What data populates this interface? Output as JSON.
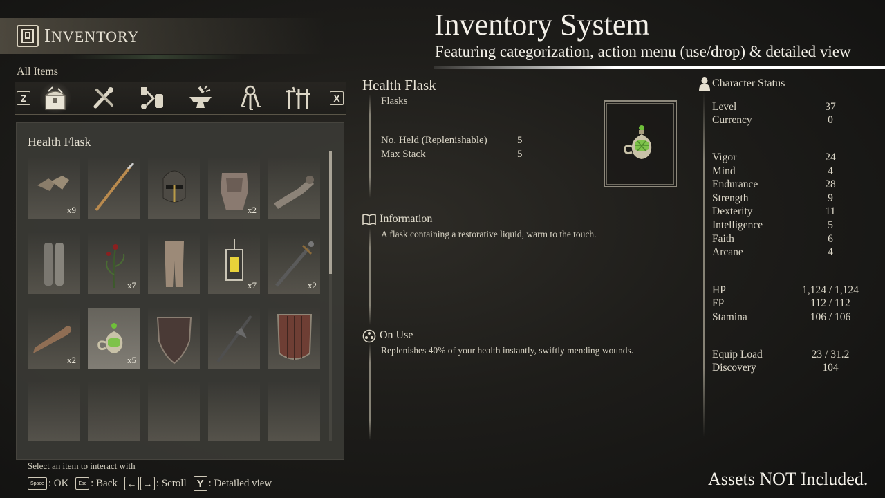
{
  "header": {
    "inventory_title_cap": "I",
    "inventory_title_rest": "NVENTORY",
    "main_title": "Inventory System",
    "sub_title": "Featuring categorization, action menu (use/drop) & detailed view"
  },
  "filter": {
    "label": "All Items",
    "prev_key": "Z",
    "next_key": "X",
    "categories": [
      {
        "icon": "chest-icon",
        "active": true
      },
      {
        "icon": "tools-icon",
        "active": false
      },
      {
        "icon": "crafting-icon",
        "active": false
      },
      {
        "icon": "anvil-icon",
        "active": false
      },
      {
        "icon": "keys-icon",
        "active": false
      },
      {
        "icon": "weapons-icon",
        "active": false
      }
    ]
  },
  "grid": {
    "title": "Health Flask",
    "slots": [
      {
        "icon": "gauntlets-icon",
        "qty": "x9"
      },
      {
        "icon": "spear-icon",
        "qty": ""
      },
      {
        "icon": "helmet-icon",
        "qty": ""
      },
      {
        "icon": "chest-armor-icon",
        "qty": "x2"
      },
      {
        "icon": "bracer-icon",
        "qty": ""
      },
      {
        "icon": "greaves-icon",
        "qty": ""
      },
      {
        "icon": "herb-icon",
        "qty": "x7"
      },
      {
        "icon": "leggings-icon",
        "qty": ""
      },
      {
        "icon": "lantern-icon",
        "qty": "x7"
      },
      {
        "icon": "sword-icon",
        "qty": "x2"
      },
      {
        "icon": "bone-icon",
        "qty": "x2"
      },
      {
        "icon": "flask-icon",
        "qty": "x5",
        "selected": true
      },
      {
        "icon": "shield-icon",
        "qty": ""
      },
      {
        "icon": "halberd-icon",
        "qty": ""
      },
      {
        "icon": "tower-shield-icon",
        "qty": ""
      },
      {
        "icon": "",
        "qty": ""
      },
      {
        "icon": "",
        "qty": ""
      },
      {
        "icon": "",
        "qty": ""
      },
      {
        "icon": "",
        "qty": ""
      },
      {
        "icon": "",
        "qty": ""
      }
    ]
  },
  "footer": {
    "hint": "Select an item to interact with",
    "ok_key": "Space",
    "ok_label": ": OK",
    "back_key": "Esc",
    "back_label": ": Back",
    "scroll_left": "←",
    "scroll_right": "→",
    "scroll_label": ": Scroll",
    "detail_key": "Y",
    "detail_label": ": Detailed view"
  },
  "detail": {
    "name": "Health Flask",
    "category": "Flasks",
    "held_label": "No. Held (Replenishable)",
    "held_value": "5",
    "stack_label": "Max Stack",
    "stack_value": "5",
    "info_title": "Information",
    "info_text": "A flask containing a restorative liquid, warm to the touch.",
    "use_title": "On Use",
    "use_text": "Replenishes 40% of your health instantly, swiftly mending wounds."
  },
  "status": {
    "title": "Character Status",
    "level_label": "Level",
    "level": "37",
    "currency_label": "Currency",
    "currency": "0",
    "attributes": [
      {
        "label": "Vigor",
        "value": "24"
      },
      {
        "label": "Mind",
        "value": "4"
      },
      {
        "label": "Endurance",
        "value": "28"
      },
      {
        "label": "Strength",
        "value": "9"
      },
      {
        "label": "Dexterity",
        "value": "11"
      },
      {
        "label": "Intelligence",
        "value": "5"
      },
      {
        "label": "Faith",
        "value": "6"
      },
      {
        "label": "Arcane",
        "value": "4"
      }
    ],
    "hp_label": "HP",
    "hp": "1,124 / 1,124",
    "fp_label": "FP",
    "fp": "112 / 112",
    "stamina_label": "Stamina",
    "stamina": "106 / 106",
    "equip_label": "Equip Load",
    "equip": "23 / 31.2",
    "discovery_label": "Discovery",
    "discovery": "104"
  },
  "notice": "Assets NOT Included.",
  "colors": {
    "accent": "#d9d2bf",
    "panel": "#3a3935",
    "flask_green": "#6fbf3a"
  }
}
